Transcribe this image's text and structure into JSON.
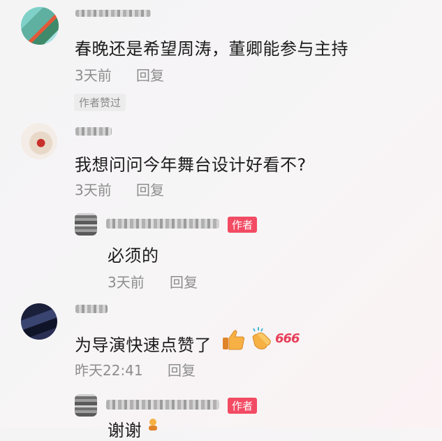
{
  "comments": [
    {
      "text": "春晚还是希望周涛，董卿能参与主持",
      "time": "3天前",
      "reply_label": "回复",
      "liked_tag": "作者赞过"
    },
    {
      "text": "我想问问今年舞台设计好看不?",
      "time": "3天前",
      "reply_label": "回复",
      "replies": [
        {
          "author_tag": "作者",
          "text": "必须的",
          "time": "3天前",
          "reply_label": "回复"
        }
      ]
    },
    {
      "text": "为导演快速点赞了",
      "emojis": [
        "thumbs-up",
        "clapping-hands",
        "666"
      ],
      "emoji_666_text": "666",
      "time": "昨天22:41",
      "reply_label": "回复",
      "replies": [
        {
          "author_tag": "作者",
          "text": "谢谢"
        }
      ]
    }
  ],
  "colors": {
    "author_tag": "#f24b63",
    "meta_text": "#8d8d8d",
    "tag_666": "#e8405a"
  }
}
